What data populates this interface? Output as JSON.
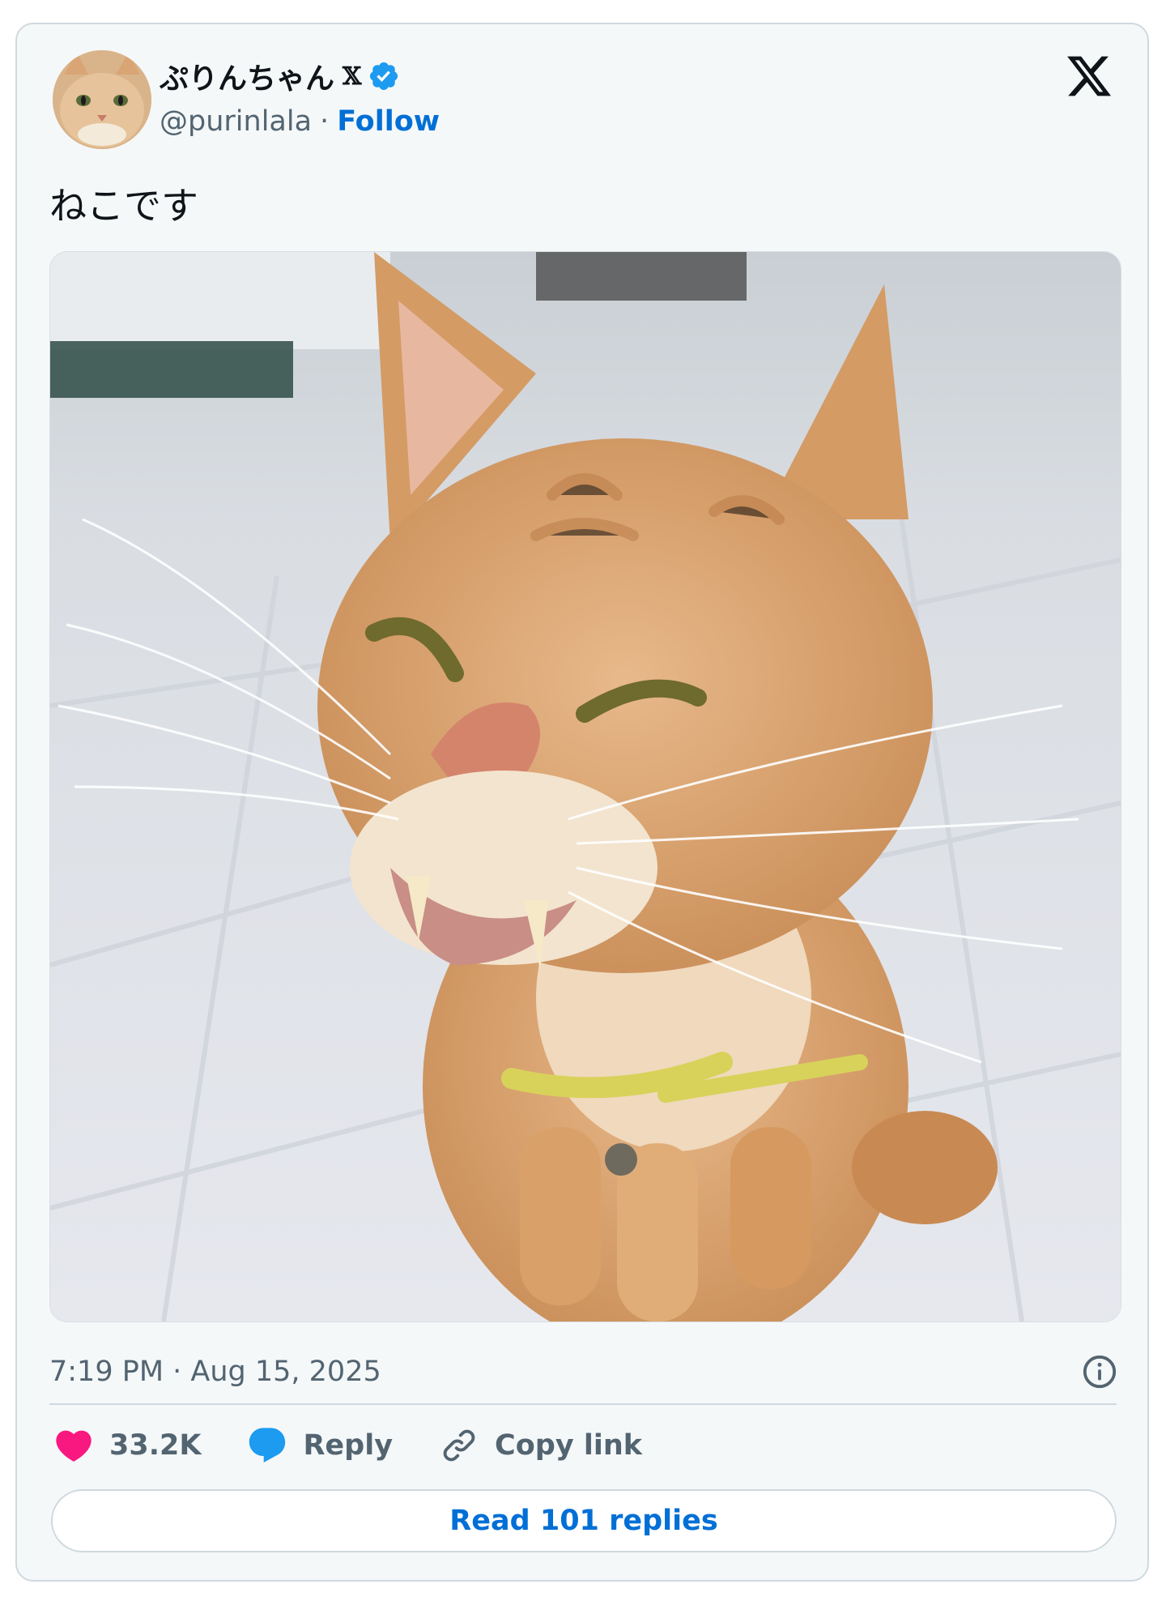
{
  "author": {
    "display_name": "ぷりんちゃん",
    "affiliate_badge": "𝕏",
    "handle": "@purinlala",
    "separator": "·",
    "follow_label": "Follow"
  },
  "tweet": {
    "text": "ねこです",
    "timestamp": "7:19 PM · Aug 15, 2025"
  },
  "actions": {
    "like_count": "33.2K",
    "reply_label": "Reply",
    "copy_label": "Copy link"
  },
  "read_replies_label": "Read 101 replies",
  "icons": {
    "logo": "x-logo-icon",
    "verified": "verified-badge-icon",
    "info": "info-icon",
    "like": "heart-icon",
    "reply": "speech-bubble-icon",
    "copy": "link-icon"
  },
  "colors": {
    "accent": "#006fd6",
    "verified": "#1d9bf0",
    "like": "#f91880",
    "reply": "#1d9bf0",
    "muted": "#536471",
    "card_bg": "#f5f8f9",
    "border": "#cfd9de"
  }
}
